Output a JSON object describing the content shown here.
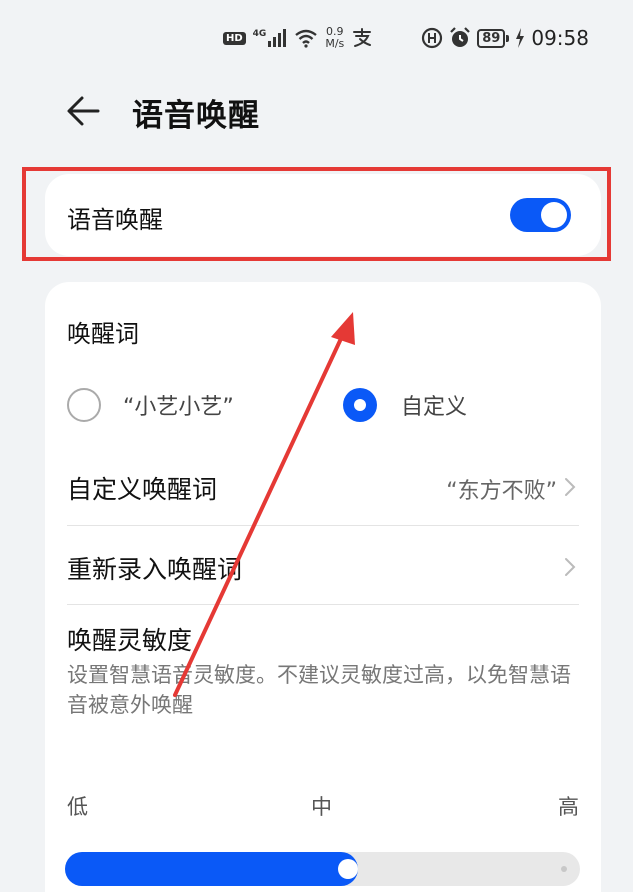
{
  "status_bar": {
    "hd": "HD",
    "network": "4G",
    "speed_value": "0.9",
    "speed_unit": "M/s",
    "battery": "89",
    "time": "09:58"
  },
  "header": {
    "title": "语音唤醒"
  },
  "voice_wakeup": {
    "label": "语音唤醒",
    "enabled": true
  },
  "wake_word": {
    "section_title": "唤醒词",
    "options": [
      {
        "label": "“小艺小艺”",
        "selected": false
      },
      {
        "label": "自定义",
        "selected": true
      }
    ]
  },
  "settings_list": [
    {
      "label": "自定义唤醒词",
      "value": "“东方不败”"
    },
    {
      "label": "重新录入唤醒词",
      "value": ""
    }
  ],
  "sensitivity": {
    "title": "唤醒灵敏度",
    "description": "设置智慧语音灵敏度。不建议灵敏度过高，以免智慧语音被意外唤醒",
    "scale_low": "低",
    "scale_mid": "中",
    "scale_high": "高",
    "level": 0.5
  },
  "colors": {
    "accent": "#0a59f7",
    "annotation": "#e53935"
  }
}
